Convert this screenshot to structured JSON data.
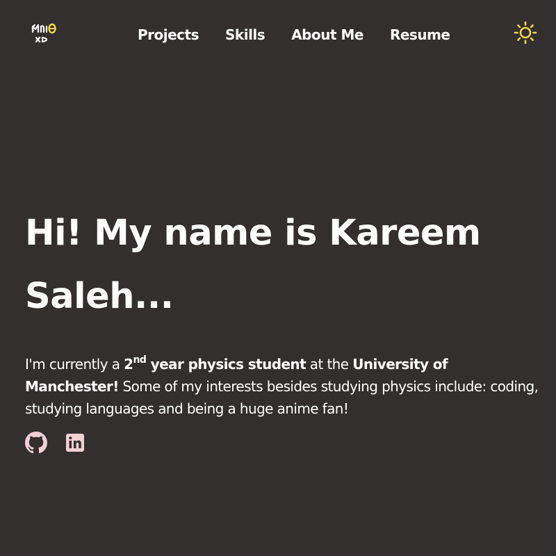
{
  "header": {
    "logo_icon": "handwritten-logo-icon",
    "nav": [
      {
        "label": "Projects"
      },
      {
        "label": "Skills"
      },
      {
        "label": "About Me"
      },
      {
        "label": "Resume"
      }
    ],
    "theme_toggle_icon": "sun-icon"
  },
  "hero": {
    "title": "Hi! My name is Kareem Saleh...",
    "intro": {
      "p1": "I'm currently a ",
      "year_number": "2",
      "year_suffix": "nd",
      "year_rest": " year physics student",
      "p2": " at the ",
      "university": "University of Manchester!",
      "p3": " Some of my interests besides studying physics include: coding, studying languages and being a huge anime fan!"
    },
    "socials": [
      {
        "icon": "github-icon"
      },
      {
        "icon": "linkedin-icon"
      }
    ]
  },
  "colors": {
    "background": "#332f2f",
    "text": "#ffffff",
    "accent_sun": "#f5d442",
    "social_icons": "#f2d0d4"
  }
}
